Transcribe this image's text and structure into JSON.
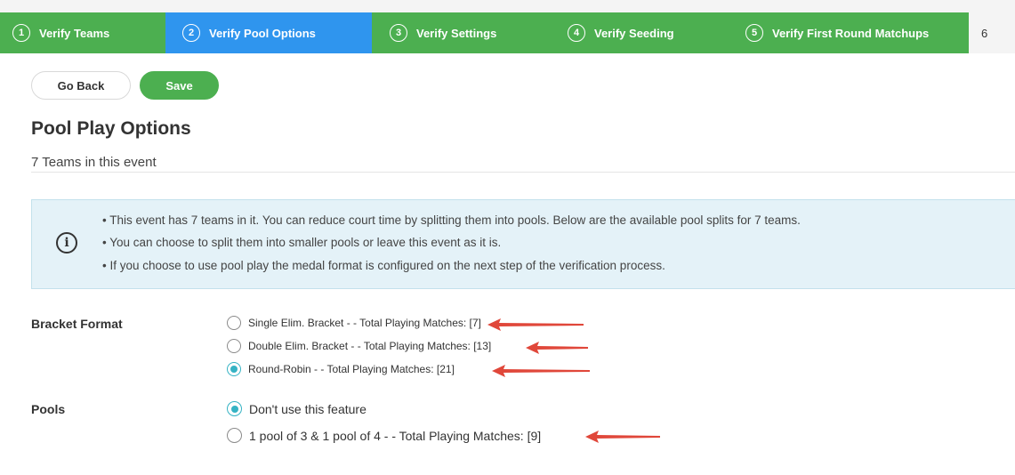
{
  "steps": [
    {
      "num": "1",
      "label": "Verify Teams",
      "active": false
    },
    {
      "num": "2",
      "label": "Verify Pool Options",
      "active": true
    },
    {
      "num": "3",
      "label": "Verify Settings",
      "active": false
    },
    {
      "num": "4",
      "label": "Verify Seeding",
      "active": false
    },
    {
      "num": "5",
      "label": "Verify First Round Matchups",
      "active": false
    },
    {
      "num": "6",
      "label": "",
      "active": false
    }
  ],
  "toolbar": {
    "back_label": "Go Back",
    "save_label": "Save"
  },
  "page": {
    "title": "Pool Play Options",
    "subtitle": "7 Teams in this event"
  },
  "info": {
    "icon": "info-circle-icon",
    "lines": [
      "• This event has 7 teams in it. You can reduce court time by splitting them into pools. Below are the available pool splits for 7 teams.",
      "• You can choose to split them into smaller pools or leave this event as it is.",
      "• If you choose to use pool play the medal format is configured on the next step of the verification process."
    ]
  },
  "bracket_format": {
    "label": "Bracket Format",
    "options": [
      {
        "label": "Single Elim. Bracket - - Total Playing Matches: [7]",
        "checked": false
      },
      {
        "label": "Double Elim. Bracket - - Total Playing Matches: [13]",
        "checked": false
      },
      {
        "label": "Round-Robin - - Total Playing Matches: [21]",
        "checked": true
      }
    ]
  },
  "pools": {
    "label": "Pools",
    "options": [
      {
        "label": "Don't use this feature",
        "checked": true
      },
      {
        "label": "1 pool of 3 & 1 pool of 4 - - Total Playing Matches: [9]",
        "checked": false
      }
    ]
  },
  "colors": {
    "step_green": "#4caf50",
    "step_active_blue": "#2f95ee",
    "radio_checked": "#35b3c4",
    "info_background": "#e4f2f8",
    "annotation_arrow_red": "#e0473a"
  }
}
